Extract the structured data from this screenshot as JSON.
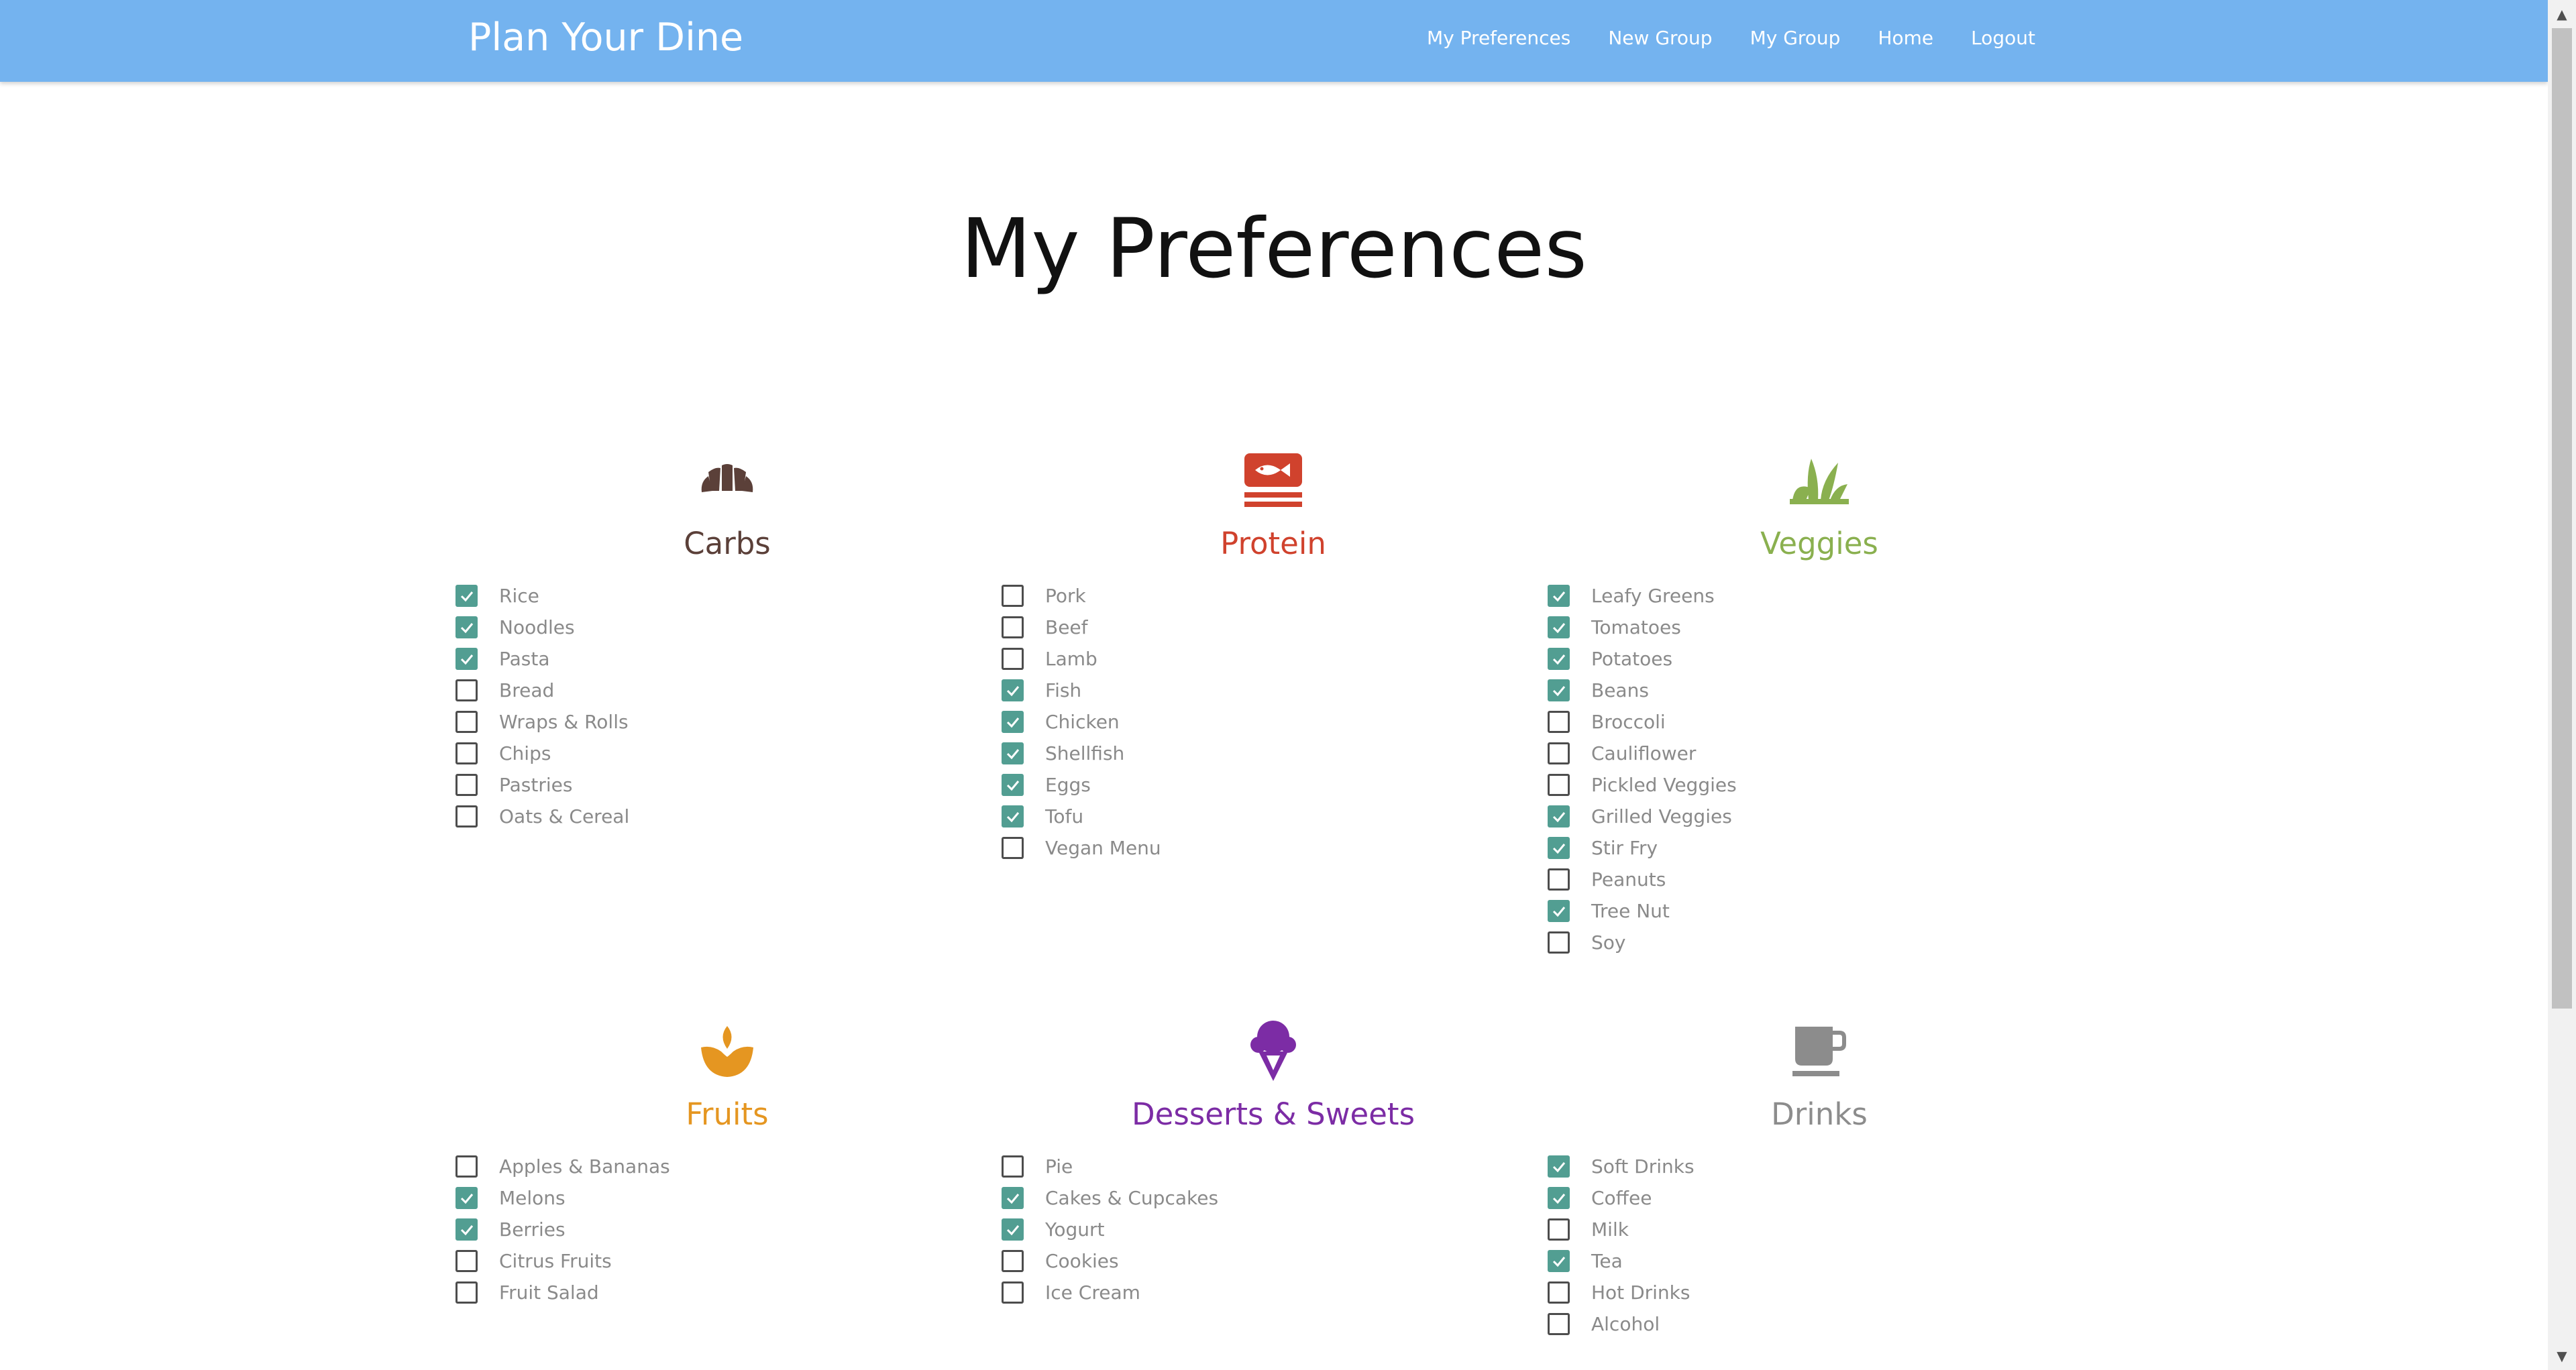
{
  "navbar": {
    "brand": "Plan Your Dine",
    "links": [
      "My Preferences",
      "New Group",
      "My Group",
      "Home",
      "Logout"
    ]
  },
  "page": {
    "title": "My Preferences"
  },
  "categories": [
    {
      "title": "Carbs",
      "color": "#5b4039",
      "icon": "croissant-icon",
      "items": [
        {
          "label": "Rice",
          "checked": true
        },
        {
          "label": "Noodles",
          "checked": true
        },
        {
          "label": "Pasta",
          "checked": true
        },
        {
          "label": "Bread",
          "checked": false
        },
        {
          "label": "Wraps & Rolls",
          "checked": false
        },
        {
          "label": "Chips",
          "checked": false
        },
        {
          "label": "Pastries",
          "checked": false
        },
        {
          "label": "Oats & Cereal",
          "checked": false
        }
      ]
    },
    {
      "title": "Protein",
      "color": "#d0422d",
      "icon": "fish-icon",
      "items": [
        {
          "label": "Pork",
          "checked": false
        },
        {
          "label": "Beef",
          "checked": false
        },
        {
          "label": "Lamb",
          "checked": false
        },
        {
          "label": "Fish",
          "checked": true
        },
        {
          "label": "Chicken",
          "checked": true
        },
        {
          "label": "Shellfish",
          "checked": true
        },
        {
          "label": "Eggs",
          "checked": true
        },
        {
          "label": "Tofu",
          "checked": true
        },
        {
          "label": "Vegan Menu",
          "checked": false
        }
      ]
    },
    {
      "title": "Veggies",
      "color": "#8ab04f",
      "icon": "leaf-sprout-icon",
      "items": [
        {
          "label": "Leafy Greens",
          "checked": true
        },
        {
          "label": "Tomatoes",
          "checked": true
        },
        {
          "label": "Potatoes",
          "checked": true
        },
        {
          "label": "Beans",
          "checked": true
        },
        {
          "label": "Broccoli",
          "checked": false
        },
        {
          "label": "Cauliflower",
          "checked": false
        },
        {
          "label": "Pickled Veggies",
          "checked": false
        },
        {
          "label": "Grilled Veggies",
          "checked": true
        },
        {
          "label": "Stir Fry",
          "checked": true
        },
        {
          "label": "Peanuts",
          "checked": false
        },
        {
          "label": "Tree Nut",
          "checked": true
        },
        {
          "label": "Soy",
          "checked": false
        }
      ]
    },
    {
      "title": "Fruits",
      "color": "#e59621",
      "icon": "fruit-icon",
      "items": [
        {
          "label": "Apples & Bananas",
          "checked": false
        },
        {
          "label": "Melons",
          "checked": true
        },
        {
          "label": "Berries",
          "checked": true
        },
        {
          "label": "Citrus Fruits",
          "checked": false
        },
        {
          "label": "Fruit Salad",
          "checked": false
        }
      ]
    },
    {
      "title": "Desserts & Sweets",
      "color": "#7c2ca5",
      "icon": "ice-cream-icon",
      "items": [
        {
          "label": "Pie",
          "checked": false
        },
        {
          "label": "Cakes & Cupcakes",
          "checked": true
        },
        {
          "label": "Yogurt",
          "checked": true
        },
        {
          "label": "Cookies",
          "checked": false
        },
        {
          "label": "Ice Cream",
          "checked": false
        }
      ]
    },
    {
      "title": "Drinks",
      "color": "#8c8c8c",
      "icon": "cup-icon",
      "items": [
        {
          "label": "Soft Drinks",
          "checked": true
        },
        {
          "label": "Coffee",
          "checked": true
        },
        {
          "label": "Milk",
          "checked": false
        },
        {
          "label": "Tea",
          "checked": true
        },
        {
          "label": "Hot Drinks",
          "checked": false
        },
        {
          "label": "Alcohol",
          "checked": false
        }
      ]
    }
  ]
}
